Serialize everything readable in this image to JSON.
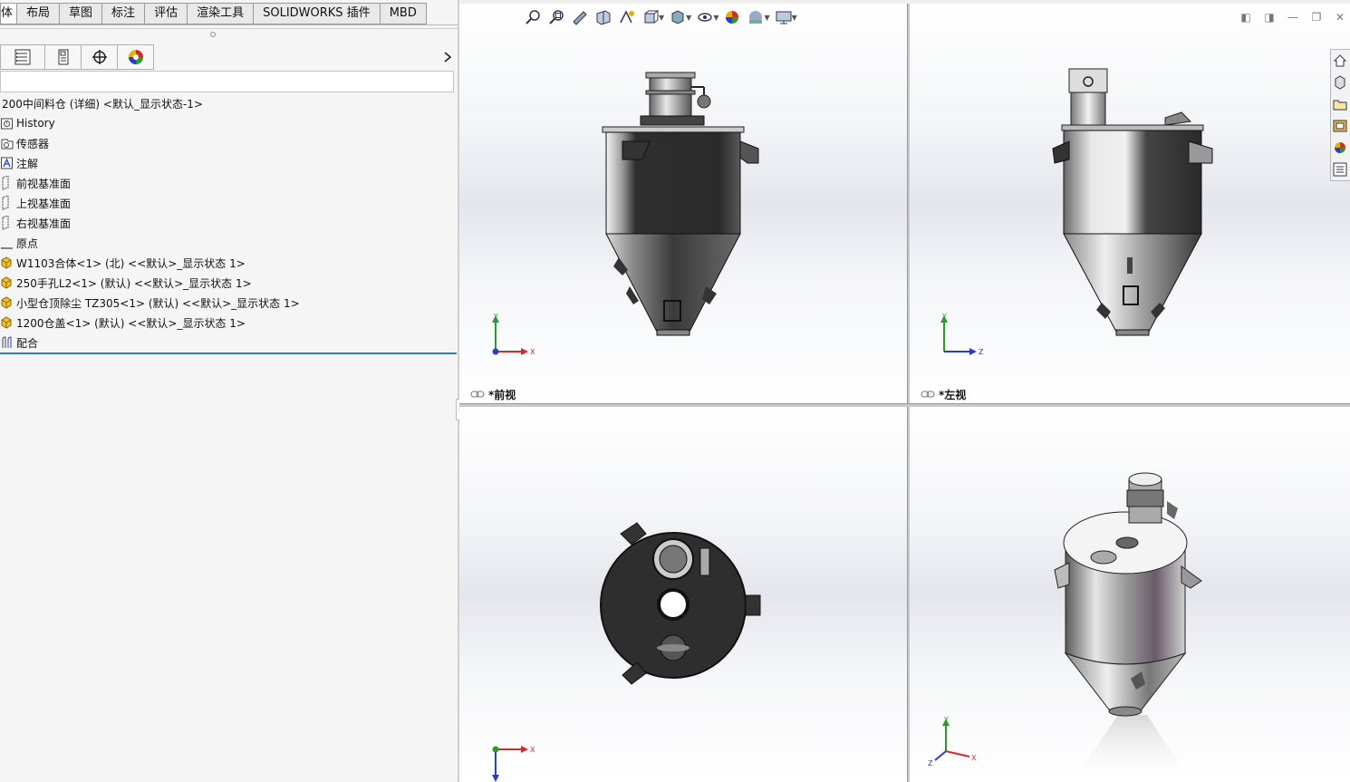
{
  "tabs": [
    "体",
    "布局",
    "草图",
    "标注",
    "评估",
    "渲染工具",
    "SOLIDWORKS 插件",
    "MBD"
  ],
  "feature_manager": {
    "toolbar_icons": [
      "feature-tree-icon",
      "property-manager-icon",
      "configuration-manager-icon",
      "appearance-icon"
    ],
    "filter_placeholder": "",
    "tree": [
      {
        "label": "200中间料仓 (详细) <默认_显示状态-1>",
        "icon": "none",
        "indent": 0
      },
      {
        "label": "History",
        "icon": "history-icon",
        "indent": 1
      },
      {
        "label": "传感器",
        "icon": "sensor-icon",
        "indent": 1
      },
      {
        "label": "注解",
        "icon": "annotation-icon",
        "indent": 1
      },
      {
        "label": "前视基准面",
        "icon": "plane-icon",
        "indent": 1
      },
      {
        "label": "上视基准面",
        "icon": "plane-icon",
        "indent": 1
      },
      {
        "label": "右视基准面",
        "icon": "plane-icon",
        "indent": 1
      },
      {
        "label": "原点",
        "icon": "origin-icon",
        "indent": 1
      },
      {
        "label": "W1103合体<1> (北) <<默认>_显示状态 1>",
        "icon": "assembly-icon",
        "indent": 1
      },
      {
        "label": "250手孔L2<1> (默认) <<默认>_显示状态 1>",
        "icon": "assembly-icon",
        "indent": 1
      },
      {
        "label": "小型仓顶除尘  TZ305<1> (默认) <<默认>_显示状态 1>",
        "icon": "assembly-icon",
        "indent": 1
      },
      {
        "label": "1200仓盖<1> (默认) <<默认>_显示状态 1>",
        "icon": "assembly-icon",
        "indent": 1
      },
      {
        "label": "配合",
        "icon": "mates-icon",
        "indent": 1
      }
    ]
  },
  "viewports": {
    "front": {
      "label": "*前视"
    },
    "left": {
      "label": "*左视"
    }
  },
  "heads_up_toolbar": [
    "zoom-to-fit-icon",
    "zoom-to-area-icon",
    "previous-view-icon",
    "section-view-icon",
    "dynamic-annotation-icon",
    "view-orientation-icon",
    "display-style-icon",
    "hide-show-icon",
    "edit-appearance-icon",
    "apply-scene-icon",
    "view-settings-icon"
  ],
  "axes": {
    "x": "X",
    "y": "Y",
    "z": "Z"
  },
  "colors": {
    "accent_blue": "#2d7bd4",
    "axis_x": "#d42a2a",
    "axis_y": "#2a9a2a",
    "axis_z": "#2a3ad4"
  }
}
